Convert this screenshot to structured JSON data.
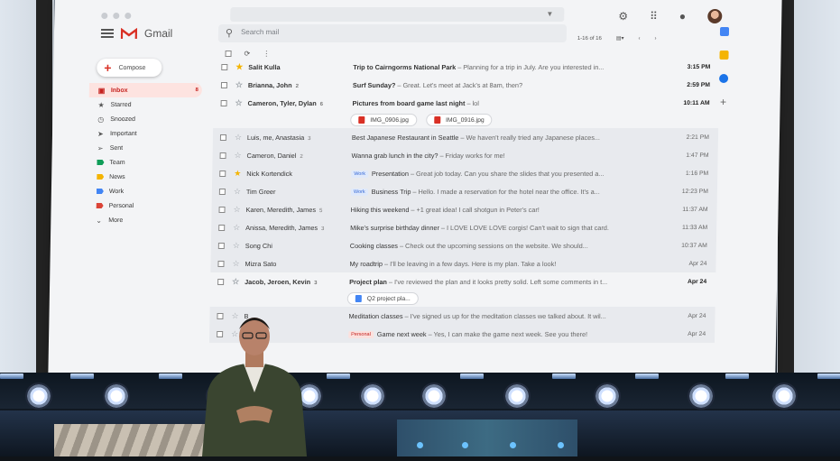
{
  "app": {
    "name": "Gmail"
  },
  "search": {
    "placeholder": "Search mail"
  },
  "compose": {
    "label": "Compose"
  },
  "pager": {
    "range": "1-16 of 16"
  },
  "nav": [
    {
      "label": "Inbox",
      "count": "8",
      "active": true,
      "icon": "inbox-icon"
    },
    {
      "label": "Starred",
      "icon": "star-icon"
    },
    {
      "label": "Snoozed",
      "icon": "clock-icon"
    },
    {
      "label": "Important",
      "icon": "important-icon"
    },
    {
      "label": "Sent",
      "icon": "send-icon"
    },
    {
      "label": "Team",
      "color": "#0f9d58"
    },
    {
      "label": "News",
      "color": "#f4b400"
    },
    {
      "label": "Work",
      "color": "#4285f4"
    },
    {
      "label": "Personal",
      "color": "#db4437"
    },
    {
      "label": "More",
      "icon": "chevron-down-icon"
    }
  ],
  "emails": [
    {
      "sender": "Salit Kulla",
      "count": "",
      "subject": "Trip to Cairngorms National Park",
      "snippet": " – Planning for a trip in July. Are you interested in...",
      "time": "3:15 PM",
      "unread": true,
      "starred": true,
      "label": ""
    },
    {
      "sender": "Brianna, John",
      "count": "2",
      "subject": "Surf Sunday?",
      "snippet": " – Great. Let's meet at Jack's at 8am, then?",
      "time": "2:59 PM",
      "unread": true,
      "starred": false,
      "label": ""
    },
    {
      "sender": "Cameron, Tyler, Dylan",
      "count": "6",
      "subject": "Pictures from board game last night",
      "snippet": " – lol",
      "time": "10:11 AM",
      "unread": true,
      "starred": false,
      "label": "",
      "attachments": [
        "IMG_0906.jpg",
        "IMG_0916.jpg"
      ]
    },
    {
      "sender": "Luis, me, Anastasia",
      "count": "3",
      "subject": "Best Japanese Restaurant in Seattle",
      "snippet": " – We haven't really tried any Japanese places...",
      "time": "2:21 PM",
      "unread": false,
      "starred": false,
      "label": ""
    },
    {
      "sender": "Cameron, Daniel",
      "count": "2",
      "subject": "Wanna grab lunch in the city?",
      "snippet": " – Friday works for me!",
      "time": "1:47 PM",
      "unread": false,
      "starred": false,
      "label": ""
    },
    {
      "sender": "Nick Kortendick",
      "count": "",
      "subject": "Presentation",
      "snippet": " – Great job today. Can you share the slides that you presented a...",
      "time": "1:16 PM",
      "unread": false,
      "starred": true,
      "label": "Work"
    },
    {
      "sender": "Tim Greer",
      "count": "",
      "subject": "Business Trip",
      "snippet": " – Hello. I made a reservation for the hotel near the office. It's a...",
      "time": "12:23 PM",
      "unread": false,
      "starred": false,
      "label": "Work"
    },
    {
      "sender": "Karen, Meredith, James",
      "count": "5",
      "subject": "Hiking this weekend",
      "snippet": " – +1 great idea! I call shotgun in Peter's car!",
      "time": "11:37 AM",
      "unread": false,
      "starred": false,
      "label": ""
    },
    {
      "sender": "Anissa, Meredith, James",
      "count": "3",
      "subject": "Mike's surprise birthday dinner",
      "snippet": " – I LOVE LOVE LOVE corgis! Can't wait to sign that card.",
      "time": "11:33 AM",
      "unread": false,
      "starred": false,
      "label": ""
    },
    {
      "sender": "Song Chi",
      "count": "",
      "subject": "Cooking classes",
      "snippet": " – Check out the upcoming sessions on the website. We should...",
      "time": "10:37 AM",
      "unread": false,
      "starred": false,
      "label": ""
    },
    {
      "sender": "Mizra Sato",
      "count": "",
      "subject": "My roadtrip",
      "snippet": " – I'll be leaving in a few days. Here is my plan. Take a look!",
      "time": "Apr 24",
      "unread": false,
      "starred": false,
      "label": ""
    },
    {
      "sender": "Jacob, Jeroen, Kevin",
      "count": "3",
      "subject": "Project plan",
      "snippet": " – I've reviewed the plan and it looks pretty solid. Left some comments in t...",
      "time": "Apr 24",
      "unread": true,
      "starred": false,
      "label": "",
      "attachments": [
        "Q2 project pla..."
      ]
    },
    {
      "sender": "B",
      "count": "",
      "subject": "Meditation classes",
      "snippet": " – I've signed us up for the meditation classes we talked about. It wil...",
      "time": "Apr 24",
      "unread": false,
      "starred": false,
      "label": ""
    },
    {
      "sender": "Ren",
      "count": "",
      "subject": "Game next week",
      "snippet": " – Yes, I can make the game next week. See you there!",
      "time": "Apr 24",
      "unread": false,
      "starred": false,
      "label": "Personal"
    }
  ],
  "colors": {
    "accent": "#d93025",
    "work_label": "#4285f4",
    "personal_label": "#db4437"
  }
}
